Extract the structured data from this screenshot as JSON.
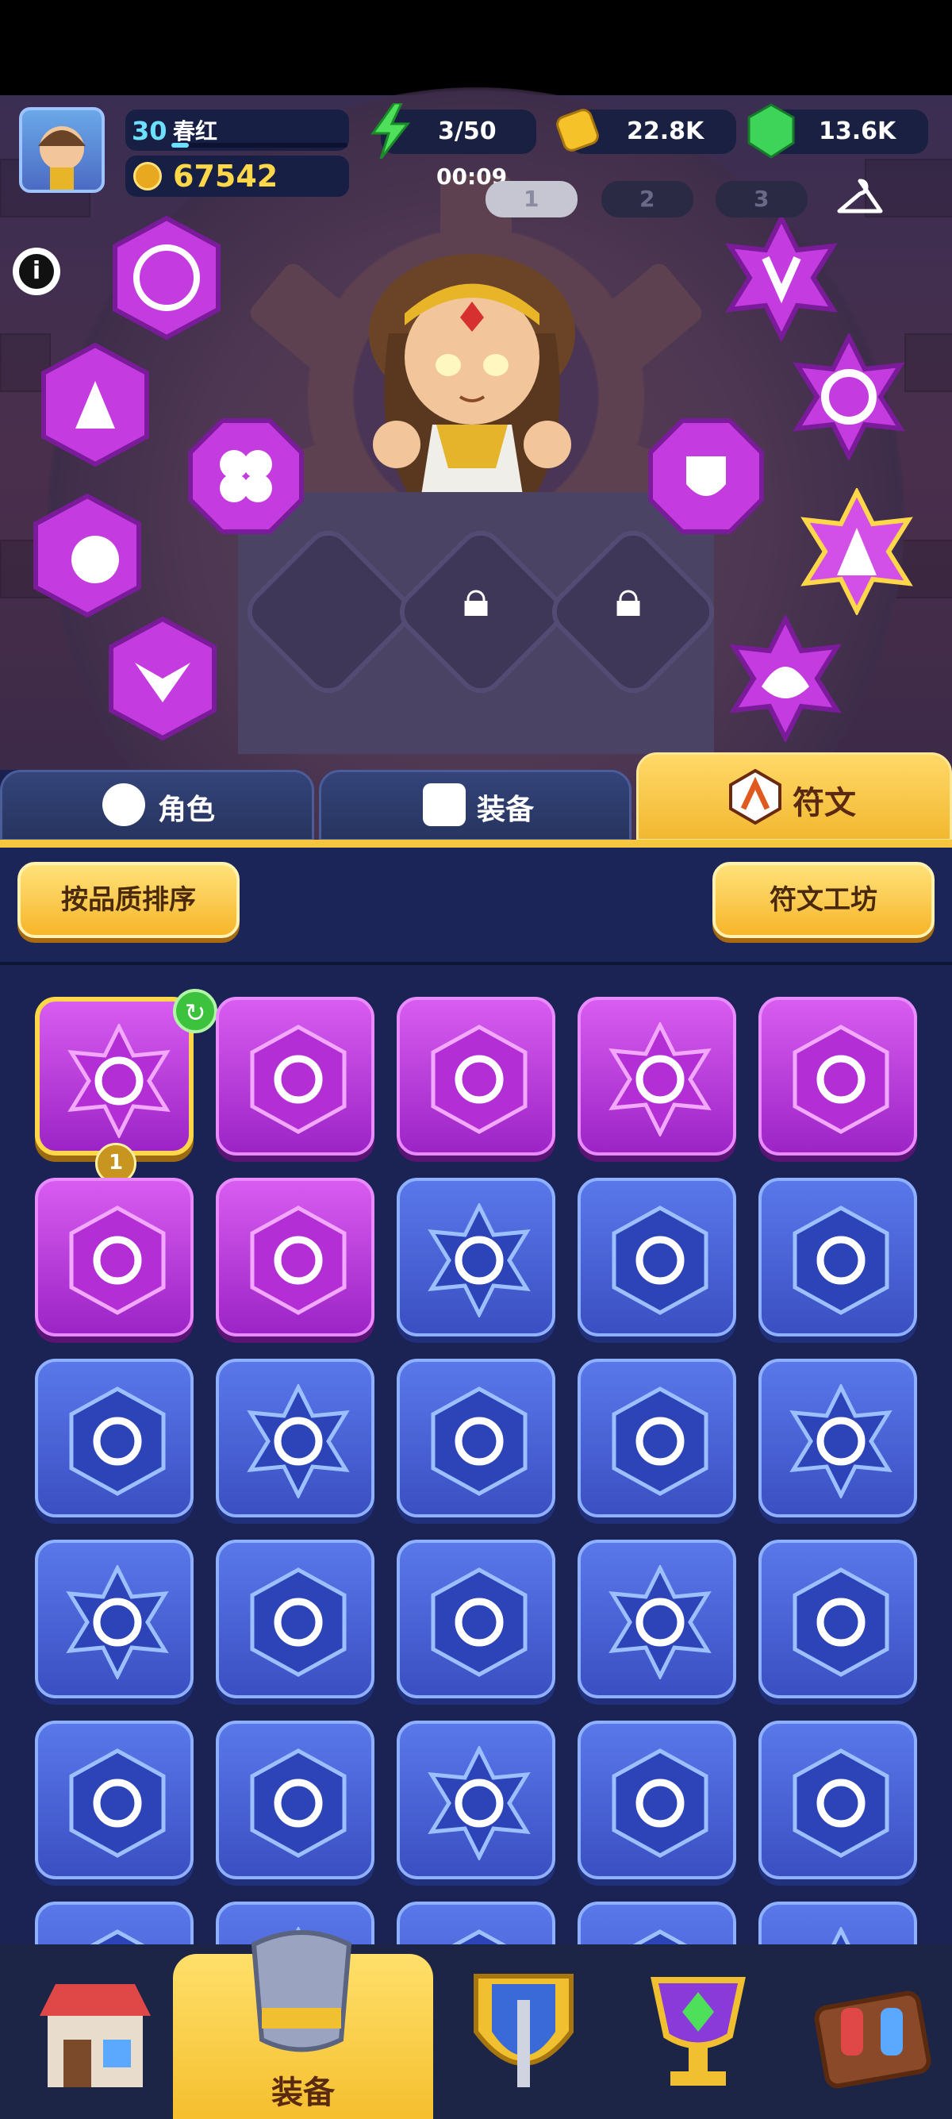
{
  "header": {
    "player_level": "30",
    "player_name": "春红",
    "gold_amount": "67542",
    "energy": "3/50",
    "energy_timer": "00:09",
    "coins": "22.8K",
    "gems": "13.6K",
    "loadout_slots": [
      "1",
      "2",
      "3"
    ]
  },
  "tabs": [
    {
      "label": "角色",
      "icon": "character-icon"
    },
    {
      "label": "装备",
      "icon": "armor-icon"
    },
    {
      "label": "符文",
      "icon": "rune-icon"
    }
  ],
  "toolbar": {
    "sort_label": "按品质排序",
    "workshop_label": "符文工坊"
  },
  "rune_grid": {
    "selected_badge": "1",
    "rows": [
      [
        {
          "tier": "purple",
          "icon": "flame-swirl-rune"
        },
        {
          "tier": "purple",
          "icon": "comet-rune"
        },
        {
          "tier": "purple",
          "icon": "fire-burst-rune"
        },
        {
          "tier": "purple",
          "icon": "fire-clock-rune"
        },
        {
          "tier": "purple",
          "icon": "comet-house-rune"
        }
      ],
      [
        {
          "tier": "purple",
          "icon": "time-arrow-rune"
        },
        {
          "tier": "purple",
          "icon": "shield-slash-rune"
        },
        {
          "tier": "blue",
          "icon": "saw-ring-rune"
        },
        {
          "tier": "blue",
          "icon": "comet-rune"
        },
        {
          "tier": "blue",
          "icon": "dragon-rune"
        }
      ],
      [
        {
          "tier": "blue",
          "icon": "boomerang-rune"
        },
        {
          "tier": "blue",
          "icon": "boomerang-rune"
        },
        {
          "tier": "blue",
          "icon": "sawblade-x2-rune"
        },
        {
          "tier": "blue",
          "icon": "sawblade-x2-rune"
        },
        {
          "tier": "blue",
          "icon": "sawblade-rune"
        }
      ],
      [
        {
          "tier": "blue",
          "icon": "sawblade-house-rune"
        },
        {
          "tier": "blue",
          "icon": "bow-rune"
        },
        {
          "tier": "blue",
          "icon": "bow-house-rune"
        },
        {
          "tier": "blue",
          "icon": "fire-burst-rune"
        },
        {
          "tier": "blue",
          "icon": "fire-clock-rune"
        }
      ],
      [
        {
          "tier": "blue",
          "icon": "comet-star-rune"
        },
        {
          "tier": "blue",
          "icon": "comet-house-rune"
        },
        {
          "tier": "blue",
          "icon": "lotus-rune"
        },
        {
          "tier": "blue",
          "icon": "ring-rune"
        },
        {
          "tier": "blue",
          "icon": "ring-heart-rune"
        }
      ],
      [
        {
          "tier": "blue",
          "icon": "rune"
        },
        {
          "tier": "blue",
          "icon": "rune"
        },
        {
          "tier": "blue",
          "icon": "rune"
        },
        {
          "tier": "blue",
          "icon": "rune"
        },
        {
          "tier": "blue",
          "icon": "rune"
        }
      ]
    ]
  },
  "bottom_nav": [
    {
      "name": "shop",
      "label": ""
    },
    {
      "name": "equipment",
      "label": "装备"
    },
    {
      "name": "heroes",
      "label": ""
    },
    {
      "name": "trophy",
      "label": ""
    },
    {
      "name": "events",
      "label": ""
    }
  ],
  "colors": {
    "purple_rune": "#c040e0",
    "blue_rune": "#4a63d8",
    "gold_button": "#f7c640",
    "active_tab": "#f7c640"
  }
}
